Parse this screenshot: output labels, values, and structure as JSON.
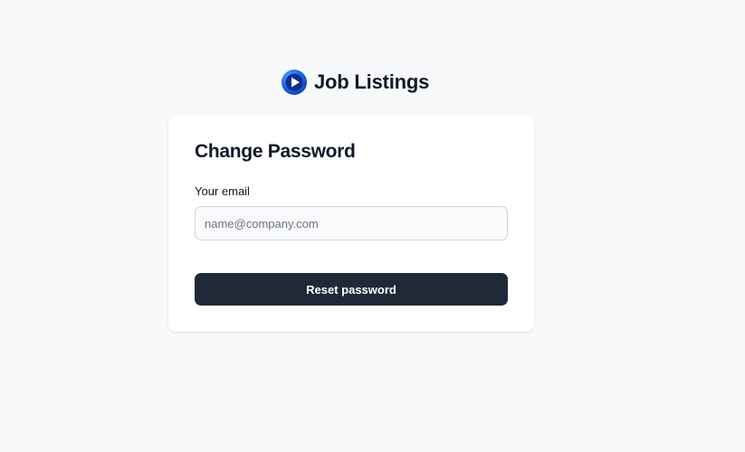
{
  "brand": {
    "name": "Job Listings",
    "logo_icon": "play-logo-icon",
    "logo_color": "#1c64f2"
  },
  "form": {
    "title": "Change Password",
    "email_label": "Your email",
    "email_value": "",
    "email_placeholder": "name@company.com",
    "submit_label": "Reset password",
    "button_color": "#1f2937"
  }
}
